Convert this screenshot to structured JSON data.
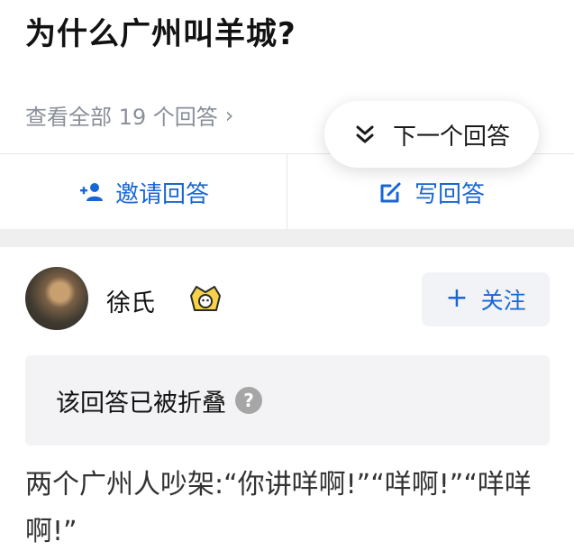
{
  "question": {
    "title": "为什么广州叫羊城?",
    "view_all": "查看全部 19 个回答",
    "view_all_chevron": "›"
  },
  "floating": {
    "next_answer_label": "下一个回答",
    "icon": "double-chevron-down-icon"
  },
  "actions": {
    "invite_label": "邀请回答",
    "invite_icon": "add-user-icon",
    "write_label": "写回答",
    "write_icon": "edit-icon",
    "accent_color": "#1766d6"
  },
  "answer": {
    "author_name": "徐氏",
    "badge_icon": "award-badge-icon",
    "follow_label": "关注",
    "follow_plus": "+",
    "folded_notice": "该回答已被折叠",
    "help_glyph": "?",
    "body": "两个广州人吵架:“你讲咩啊!”“咩啊!”“咩咩啊!”"
  }
}
